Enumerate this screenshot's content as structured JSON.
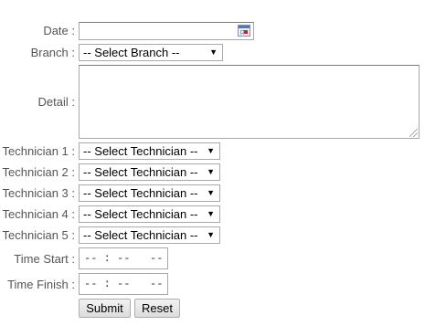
{
  "form": {
    "date": {
      "label": "Date :",
      "value": ""
    },
    "branch": {
      "label": "Branch :",
      "selected": "-- Select Branch --"
    },
    "detail": {
      "label": "Detail :",
      "value": ""
    },
    "technicians": [
      {
        "label": "Technician 1 :",
        "selected": "-- Select Technician --"
      },
      {
        "label": "Technician 2 :",
        "selected": "-- Select Technician --"
      },
      {
        "label": "Technician 3 :",
        "selected": "-- Select Technician --"
      },
      {
        "label": "Technician 4 :",
        "selected": "-- Select Technician --"
      },
      {
        "label": "Technician 5 :",
        "selected": "-- Select Technician --"
      }
    ],
    "time_start": {
      "label": "Time Start :",
      "value": "-- : --   --"
    },
    "time_finish": {
      "label": "Time Finish :",
      "value": "-- : --   --"
    },
    "submit_label": "Submit",
    "reset_label": "Reset"
  },
  "icons": {
    "calendar": "calendar-icon",
    "dropdown": "▼"
  }
}
